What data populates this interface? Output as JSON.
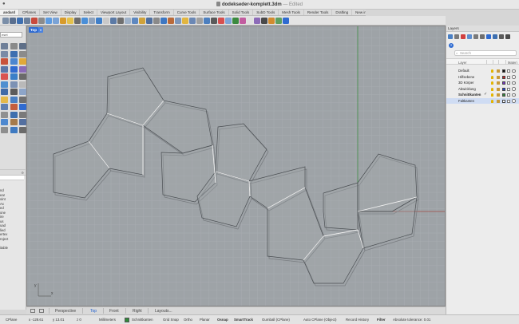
{
  "window": {
    "title": "dodekseder-komplett.3dm",
    "edited": "— Edited"
  },
  "tabs": [
    "andard",
    "CPlanes",
    "Set View",
    "Display",
    "Select",
    "Viewport Layout",
    "Visibility",
    "Transform",
    "Curve Tools",
    "Surface Tools",
    "Solid Tools",
    "SubD Tools",
    "Mesh Tools",
    "Render Tools",
    "Drafting",
    "New in V8"
  ],
  "toolbar": {
    "colors": [
      "#7a8ea8",
      "#5a6f8f",
      "#3e6fb0",
      "#6a7f9c",
      "#c84a3c",
      "#8b8b8b",
      "#5d9be0",
      "#7aa3d6",
      "#d89b2b",
      "#e4c14b",
      "#6c6c6c",
      "#4a8fd8",
      "#8fa3bd",
      "#3f7fc9",
      "#c9c9c9",
      "#5b7aa6",
      "#6f6f6f",
      "#9fb2c9",
      "#5e88c0",
      "#d0a23a",
      "#4f6f9f",
      "#8a8a8a",
      "#3d77c2",
      "#b96a3a",
      "#7e97ba",
      "#e2b640",
      "#6b88b5",
      "#a0a0a0",
      "#4c7fbf",
      "#5a5a5a",
      "#d74f4f",
      "#7fa5d8",
      "#3b8a3f",
      "#c25da0",
      "#e0e0e0",
      "#8c6bb8",
      "#4a4a4a",
      "#d28b2f",
      "#5f9f5f",
      "#2f6bd1"
    ]
  },
  "left_tools": {
    "field_text": "eset",
    "colors": [
      "#6f7f98",
      "#8a8a8a",
      "#5e6f88",
      "#7a8aa6",
      "#3e6fb0",
      "#8b8b8b",
      "#c8543c",
      "#4c86cf",
      "#e0a93a",
      "#5a77a8",
      "#2f6bd1",
      "#8a6bb8",
      "#d9534f",
      "#3a7fc8",
      "#6a6a6a",
      "#4f8fd0",
      "#7d92b4",
      "#b9b9b9",
      "#3f6aa8",
      "#5c5c5c",
      "#8da5c8",
      "#e3b84a",
      "#4a80c4",
      "#707070",
      "#5f7fb0",
      "#c45e3e",
      "#2f6bd1",
      "#909090",
      "#3d6fae",
      "#7a7a7a",
      "#4e88cf",
      "#a57b4c",
      "#5470a0",
      "#8e8e8e",
      "#3f7ac1",
      "#6b6b6b"
    ]
  },
  "left_panel": {
    "search": "",
    "items": [
      "nd",
      "ear",
      "oint",
      "Ax",
      "ed",
      "one",
      "ire",
      "us",
      "uad",
      "lied",
      "ertex",
      "roject",
      "",
      "itable"
    ]
  },
  "viewport": {
    "name": "Top",
    "menu_arrow": "▾",
    "bg": "#9ea3a7",
    "axis_label_x": "x",
    "axis_label_y": "y"
  },
  "view_tabs": [
    "Perspective",
    "Top",
    "Front",
    "Right",
    "Layouts..."
  ],
  "status": {
    "cplane": "CPlane",
    "x": "x -128.61",
    "y": "y 13.01",
    "z": "z 0",
    "units": "Millimeters",
    "layer": "Schnittkanten",
    "toggles": [
      "Grid Snap",
      "Ortho",
      "Planar",
      "Osnap",
      "SmartTrack",
      "Gumball (CPlane)",
      "Auto CPlane (Object)",
      "Record History",
      "Filter",
      "Absolute tolerance: 0.01"
    ]
  },
  "layers_panel": {
    "header": "Layers",
    "help": "?",
    "search_placeholder": "Search",
    "col_layer": "Layer",
    "col_material": "Materi",
    "tool_colors": [
      "#4a80c4",
      "#7a7a7a",
      "#d14040",
      "#5f8fd0",
      "#7a7a7a",
      "#6f6f6f",
      "#2f6bd1",
      "#3e6fb0",
      "#5a5a5a",
      "#4a4a4a"
    ],
    "layers": [
      {
        "name": "Default",
        "color": "#111111",
        "current": false,
        "selected": false
      },
      {
        "name": "Hilfsebene",
        "color": "#cc2222",
        "current": false,
        "selected": false
      },
      {
        "name": "3D Körper",
        "color": "#7a35c8",
        "current": false,
        "selected": false
      },
      {
        "name": "Abwicklung",
        "color": "#1e3fd8",
        "current": false,
        "selected": false
      },
      {
        "name": "Schnittkanten",
        "color": "#2f8a3a",
        "current": true,
        "selected": false
      },
      {
        "name": "Faltkanten",
        "color": "#ffffff",
        "current": false,
        "selected": true
      }
    ],
    "current_mark": "✓"
  }
}
